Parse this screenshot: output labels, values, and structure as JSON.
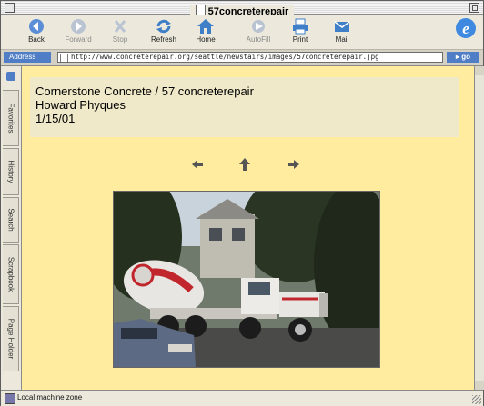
{
  "window": {
    "title": "57concreterepair"
  },
  "toolbar": {
    "buttons": [
      {
        "label": "Back",
        "icon": "back-arrow-icon",
        "enabled": true
      },
      {
        "label": "Forward",
        "icon": "forward-arrow-icon",
        "enabled": false
      },
      {
        "label": "Stop",
        "icon": "stop-icon",
        "enabled": false
      },
      {
        "label": "Refresh",
        "icon": "refresh-icon",
        "enabled": true
      },
      {
        "label": "Home",
        "icon": "home-icon",
        "enabled": true
      },
      {
        "label": "AutoFill",
        "icon": "autofill-icon",
        "enabled": false
      },
      {
        "label": "Print",
        "icon": "print-icon",
        "enabled": true
      },
      {
        "label": "Mail",
        "icon": "mail-icon",
        "enabled": true
      }
    ]
  },
  "address": {
    "label": "Address",
    "url": "http://www.concreterepair.org/seattle/newstairs/images/57concreterepair.jpg",
    "go_label": "go"
  },
  "sidebar": {
    "tabs": [
      "Favorites",
      "History",
      "Search",
      "Scrapbook",
      "Page Holder"
    ]
  },
  "page": {
    "line1": "Cornerstone Concrete / 57 concreterepair",
    "line2": "Howard Phyques",
    "line3": "1/15/01",
    "nav": [
      "previous",
      "index",
      "next"
    ],
    "photo_alt": "concrete mixer truck"
  },
  "status": {
    "text": "Local machine zone"
  },
  "colors": {
    "page_background": "#ffec9e",
    "header_box": "#efe8c9",
    "accent_blue": "#4f7ec6"
  }
}
